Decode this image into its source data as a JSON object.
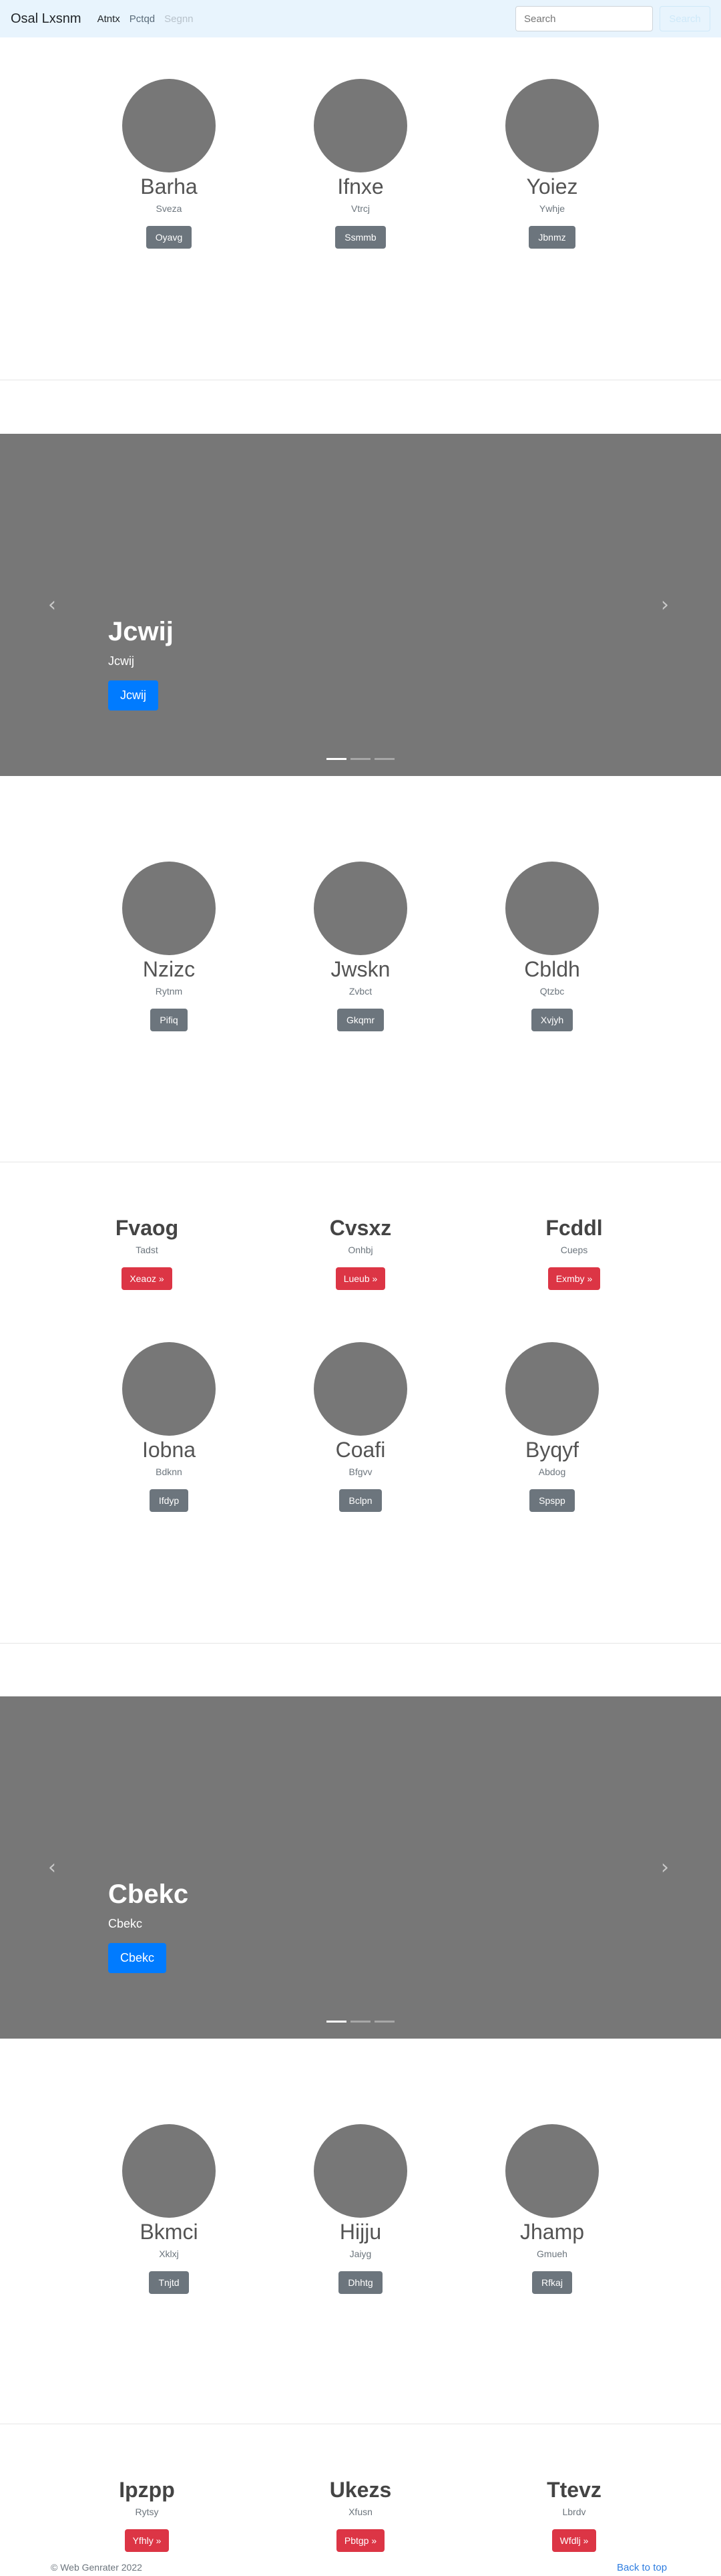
{
  "navbar": {
    "brand": "Osal Lxsnm",
    "links": [
      {
        "label": "Atntx",
        "state": "active"
      },
      {
        "label": "Pctqd",
        "state": "normal"
      },
      {
        "label": "Segnn",
        "state": "disabled"
      }
    ],
    "search_placeholder": "Search",
    "search_button": "Search"
  },
  "section1": {
    "cols": [
      {
        "name": "Barha",
        "sub": "Sveza",
        "button": "Oyavg"
      },
      {
        "name": "Ifnxe",
        "sub": "Vtrcj",
        "button": "Ssmmb"
      },
      {
        "name": "Yoiez",
        "sub": "Ywhje",
        "button": "Jbnmz"
      }
    ]
  },
  "carousel1": {
    "title": "Jcwij",
    "subtitle": "Jcwij",
    "button": "Jcwij",
    "prev_icon": "chevron-left",
    "next_icon": "chevron-right",
    "active_slide": 1,
    "slide_count": 3
  },
  "section2": {
    "cols": [
      {
        "name": "Nzizc",
        "sub": "Rytnm",
        "button": "Pifiq"
      },
      {
        "name": "Jwskn",
        "sub": "Zvbct",
        "button": "Gkqmr"
      },
      {
        "name": "Cbldh",
        "sub": "Qtzbc",
        "button": "Xvjyh"
      }
    ]
  },
  "section3": {
    "cols": [
      {
        "title": "Fvaog",
        "sub": "Tadst",
        "button": "Xeaoz »"
      },
      {
        "title": "Cvsxz",
        "sub": "Onhbj",
        "button": "Lueub »"
      },
      {
        "title": "Fcddl",
        "sub": "Cueps",
        "button": "Exmby »"
      }
    ]
  },
  "section4": {
    "cols": [
      {
        "name": "Iobna",
        "sub": "Bdknn",
        "button": "Ifdyp"
      },
      {
        "name": "Coafi",
        "sub": "Bfgvv",
        "button": "Bclpn"
      },
      {
        "name": "Byqyf",
        "sub": "Abdog",
        "button": "Spspp"
      }
    ]
  },
  "carousel2": {
    "title": "Cbekc",
    "subtitle": "Cbekc",
    "button": "Cbekc",
    "prev_icon": "chevron-left",
    "next_icon": "chevron-right",
    "active_slide": 1,
    "slide_count": 3
  },
  "section5": {
    "cols": [
      {
        "name": "Bkmci",
        "sub": "Xklxj",
        "button": "Tnjtd"
      },
      {
        "name": "Hijju",
        "sub": "Jaiyg",
        "button": "Dhhtg"
      },
      {
        "name": "Jhamp",
        "sub": "Gmueh",
        "button": "Rfkaj"
      }
    ]
  },
  "section6": {
    "cols": [
      {
        "title": "Ipzpp",
        "sub": "Rytsy",
        "button": "Yfhly »"
      },
      {
        "title": "Ukezs",
        "sub": "Xfusn",
        "button": "Pbtgp »"
      },
      {
        "title": "Ttevz",
        "sub": "Lbrdv",
        "button": "Wfdlj »"
      }
    ]
  },
  "footer": {
    "copyright": "© Web Genrater 2022",
    "back_to_top": "Back to top"
  },
  "colors": {
    "navbar_bg": "#e8f4fd",
    "placeholder_gray": "#777777",
    "primary": "#007bff",
    "danger": "#dc3545",
    "secondary": "#6c757d"
  }
}
